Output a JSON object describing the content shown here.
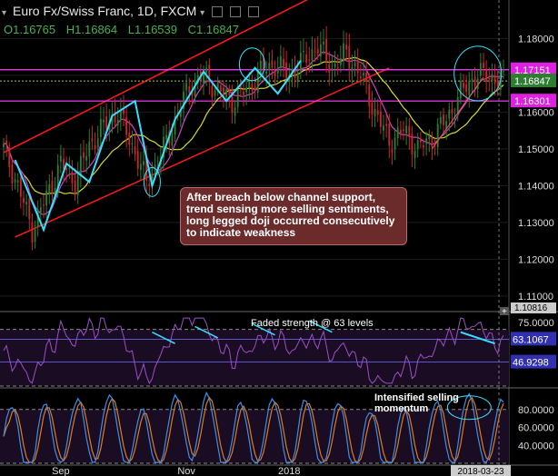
{
  "header": {
    "title": "Euro Fx/Swiss Franc, 1D, FXCM",
    "ohlc": [
      {
        "k": "O",
        "v": "1.16765"
      },
      {
        "k": "H",
        "v": "1.16864"
      },
      {
        "k": "L",
        "v": "1.16539"
      },
      {
        "k": "C",
        "v": "1.16847"
      }
    ]
  },
  "annotations": {
    "note": "After breach below channel support, trend sensing more selling sentiments, long legged doji occurred consecutively to indicate weakness",
    "rsi_label": "Faded strength @ 63 levels",
    "stoch_label": "Intensified selling momentum"
  },
  "price_tags": {
    "upper": "1.17151",
    "current": "1.16847",
    "lower": "1.16301",
    "bottom_cut": "1.10816",
    "rsi_a": "63.1067",
    "rsi_b": "46.9298",
    "date": "2018-03-23"
  },
  "colors": {
    "up": "#2e7d32",
    "down": "#c62828",
    "channel": "#ff1a1a",
    "zig": "#33e0ff",
    "ma_fast": "#d040d0",
    "ma_slow": "#d8d830",
    "hline": "#ff40ff",
    "rsi": "#9c4fc8",
    "stoch_k": "#3b8ee8",
    "stoch_d": "#e07a20"
  },
  "chart_data": [
    {
      "type": "candlestick",
      "title": "Euro Fx/Swiss Franc, 1D, FXCM",
      "x_ticks": [
        "Sep",
        "Nov",
        "2018",
        "Ma"
      ],
      "y_ticks": [
        "1.18000",
        "1.17000",
        "1.16000",
        "1.15000",
        "1.14000",
        "1.13000",
        "1.12000",
        "1.11000"
      ],
      "ylim": [
        1.107,
        1.188
      ],
      "horizontal_levels": [
        1.17151,
        1.16847,
        1.16301
      ],
      "close_path": [
        {
          "i": 0,
          "v": 1.15
        },
        {
          "i": 5,
          "v": 1.14
        },
        {
          "i": 10,
          "v": 1.128
        },
        {
          "i": 15,
          "v": 1.137
        },
        {
          "i": 20,
          "v": 1.146
        },
        {
          "i": 25,
          "v": 1.141
        },
        {
          "i": 30,
          "v": 1.151
        },
        {
          "i": 35,
          "v": 1.156
        },
        {
          "i": 40,
          "v": 1.16
        },
        {
          "i": 45,
          "v": 1.151
        },
        {
          "i": 50,
          "v": 1.141
        },
        {
          "i": 55,
          "v": 1.148
        },
        {
          "i": 60,
          "v": 1.158
        },
        {
          "i": 65,
          "v": 1.167
        },
        {
          "i": 70,
          "v": 1.17
        },
        {
          "i": 75,
          "v": 1.166
        },
        {
          "i": 80,
          "v": 1.163
        },
        {
          "i": 85,
          "v": 1.166
        },
        {
          "i": 90,
          "v": 1.171
        },
        {
          "i": 95,
          "v": 1.173
        },
        {
          "i": 100,
          "v": 1.17
        },
        {
          "i": 105,
          "v": 1.174
        },
        {
          "i": 110,
          "v": 1.178
        },
        {
          "i": 115,
          "v": 1.172
        },
        {
          "i": 120,
          "v": 1.176
        },
        {
          "i": 125,
          "v": 1.17
        },
        {
          "i": 130,
          "v": 1.16
        },
        {
          "i": 135,
          "v": 1.152
        },
        {
          "i": 140,
          "v": 1.155
        },
        {
          "i": 145,
          "v": 1.15
        },
        {
          "i": 150,
          "v": 1.153
        },
        {
          "i": 155,
          "v": 1.158
        },
        {
          "i": 160,
          "v": 1.165
        },
        {
          "i": 165,
          "v": 1.17
        },
        {
          "i": 170,
          "v": 1.17
        },
        {
          "i": 175,
          "v": 1.168
        }
      ]
    },
    {
      "type": "line",
      "title": "Faded strength @ 63 levels",
      "y_ticks": [
        "75.0000"
      ],
      "levels": [
        63.1067,
        46.9298
      ],
      "ylim": [
        30,
        80
      ]
    },
    {
      "type": "line",
      "title": "Intensified selling momentum",
      "y_ticks": [
        "80.0000",
        "60.0000",
        "40.0000"
      ],
      "x_ticks": [
        "Sep",
        "Nov",
        "2018",
        "Ma",
        "2018-03-23"
      ],
      "ylim": [
        20,
        100
      ]
    }
  ]
}
